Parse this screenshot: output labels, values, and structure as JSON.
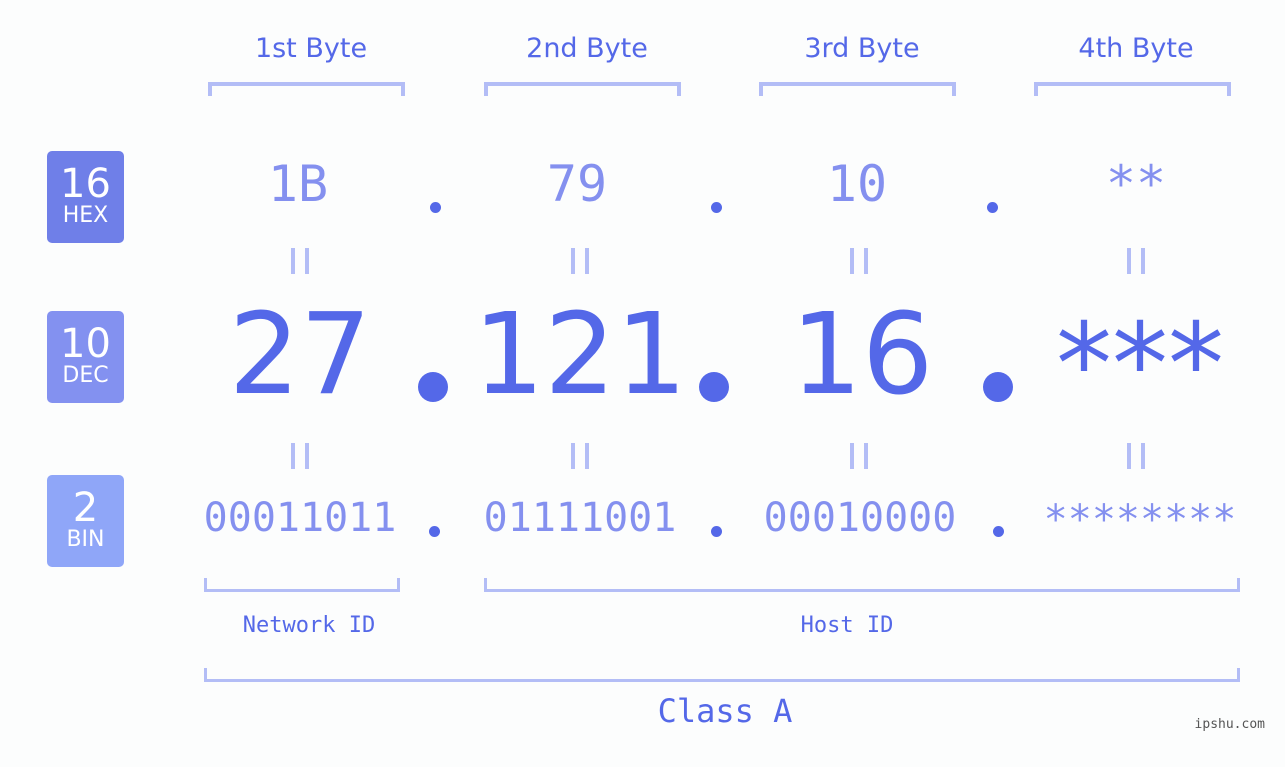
{
  "bytes": [
    {
      "header": "1st Byte",
      "hex": "1B",
      "dec": "27",
      "bin": "00011011"
    },
    {
      "header": "2nd Byte",
      "hex": "79",
      "dec": "121",
      "bin": "01111001"
    },
    {
      "header": "3rd Byte",
      "hex": "10",
      "dec": "16",
      "bin": "00010000"
    },
    {
      "header": "4th Byte",
      "hex": "**",
      "dec": "***",
      "bin": "********"
    }
  ],
  "badges": {
    "hex": {
      "num": "16",
      "label": "HEX",
      "color": "#6f7fe8"
    },
    "dec": {
      "num": "10",
      "label": "DEC",
      "color": "#8391f0"
    },
    "bin": {
      "num": "2",
      "label": "BIN",
      "color": "#8fa6f8"
    }
  },
  "network_id_label": "Network ID",
  "host_id_label": "Host ID",
  "class_label": "Class A",
  "watermark": "ipshu.com",
  "colors": {
    "primary": "#5468e8",
    "light": "#8490ef",
    "bracket": "#b3bdf6"
  }
}
